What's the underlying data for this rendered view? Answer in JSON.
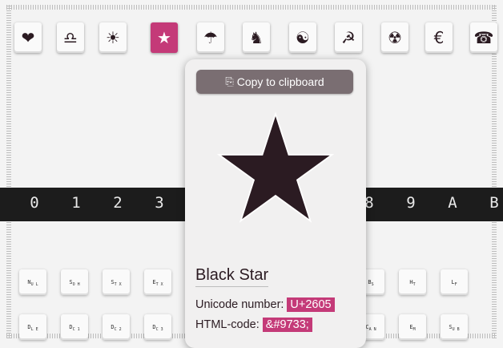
{
  "colors": {
    "accent": "#c43a78",
    "dark": "#2b1b22",
    "strip": "#1c1c1c"
  },
  "icons": [
    {
      "glyph": "❤",
      "name": "heart-icon"
    },
    {
      "glyph": "♎",
      "name": "libra-icon"
    },
    {
      "glyph": "☀",
      "name": "sun-icon"
    },
    {
      "glyph": "★",
      "name": "black-star-icon",
      "active": true
    },
    {
      "glyph": "☂",
      "name": "umbrella-icon"
    },
    {
      "glyph": "♞",
      "name": "knight-icon"
    },
    {
      "glyph": "☯",
      "name": "yin-yang-icon"
    },
    {
      "glyph": "☭",
      "name": "hammer-sickle-icon"
    },
    {
      "glyph": "☢",
      "name": "radioactive-icon"
    },
    {
      "glyph": "€",
      "name": "euro-icon"
    },
    {
      "glyph": "☎",
      "name": "telephone-icon"
    }
  ],
  "hex_labels": [
    "0",
    "1",
    "2",
    "3",
    "8",
    "9",
    "A",
    "B"
  ],
  "keys_row1": [
    {
      "main": "N",
      "sub": "U L",
      "name": "key-nul"
    },
    {
      "main": "S",
      "sub": "O H",
      "name": "key-soh"
    },
    {
      "main": "S",
      "sub": "T X",
      "name": "key-stx"
    },
    {
      "main": "E",
      "sub": "T X",
      "name": "key-etx"
    },
    {
      "main": "B",
      "sub": "S",
      "name": "key-bs"
    },
    {
      "main": "H",
      "sub": "T",
      "name": "key-ht"
    },
    {
      "main": "L",
      "sub": "F",
      "name": "key-lf"
    }
  ],
  "keys_row2": [
    {
      "main": "D",
      "sub": "L E",
      "name": "key-dle"
    },
    {
      "main": "D",
      "sub": "C 1",
      "name": "key-dc1"
    },
    {
      "main": "D",
      "sub": "C 2",
      "name": "key-dc2"
    },
    {
      "main": "D",
      "sub": "C 3",
      "name": "key-dc3"
    },
    {
      "main": "C",
      "sub": "A N",
      "name": "key-can"
    },
    {
      "main": "E",
      "sub": "M",
      "name": "key-em"
    },
    {
      "main": "S",
      "sub": "U B",
      "name": "key-sub"
    }
  ],
  "popup": {
    "copy_label": "Copy to clipboard",
    "char_name": "Black Star",
    "unicode_label": "Unicode number:",
    "unicode_value": "U+2605",
    "html_label": "HTML-code:",
    "html_value": "&#9733;"
  }
}
